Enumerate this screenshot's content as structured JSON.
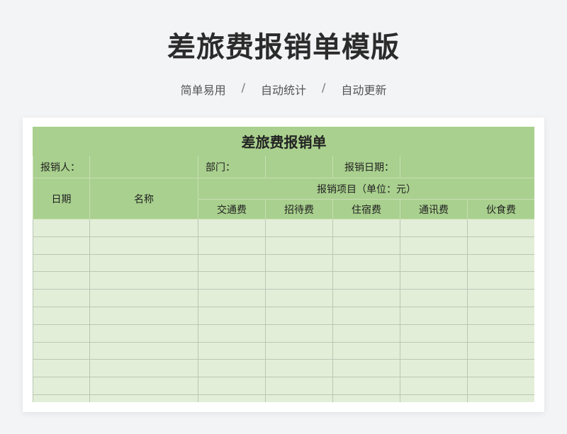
{
  "header": {
    "title": "差旅费报销单模版",
    "tags": [
      "简单易用",
      "自动统计",
      "自动更新"
    ],
    "separator": "/"
  },
  "sheet": {
    "title": "差旅费报销单",
    "reporter_label": "报销人：",
    "dept_label": "部门：",
    "date_label": "报销日期：",
    "date_col": "日期",
    "name_col": "名称",
    "items_label": "报销项目（单位：元）",
    "item_cols": [
      "交通费",
      "招待费",
      "住宿费",
      "通讯费",
      "伙食费"
    ],
    "empty_rows": 11
  },
  "colors": {
    "header_green": "#a9d08e",
    "body_green": "#e3eed8"
  }
}
